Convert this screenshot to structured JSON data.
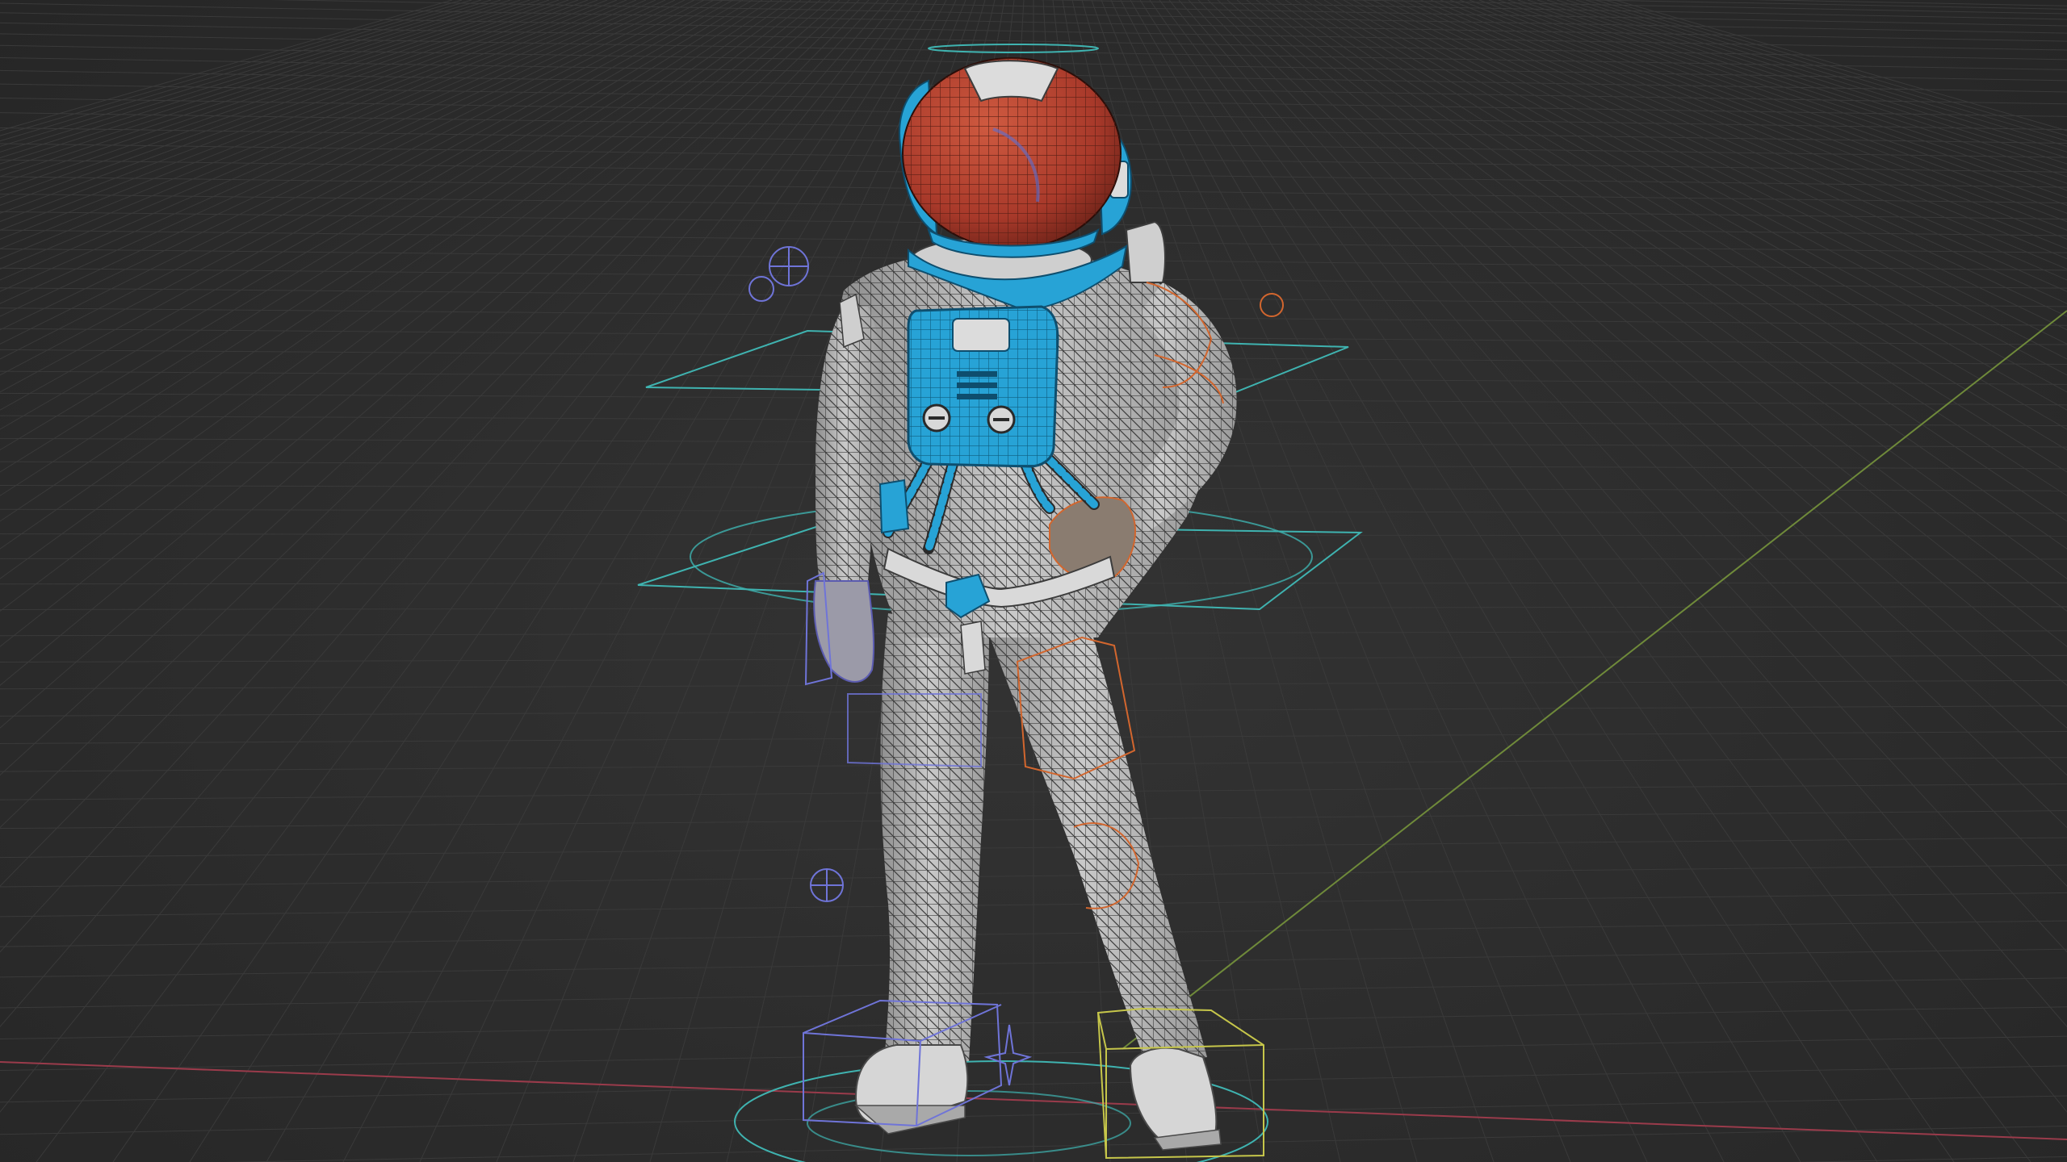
{
  "viewport": {
    "background_color": "#2b2b2b",
    "grid_color": "#3a3a3a",
    "x_axis_color": "#9a3b4b",
    "y_axis_color": "#6f8a3a"
  },
  "character": {
    "helmet_color": "#b8432f",
    "suit_color": "#b9b9b9",
    "harness_color": "#27a3d6",
    "wire_color": "#2a2a2a"
  },
  "rig": {
    "control_teal": "#3fb3b0",
    "control_blue": "#6f74d8",
    "control_orange": "#d2662e",
    "control_yellow": "#c6c64a"
  }
}
